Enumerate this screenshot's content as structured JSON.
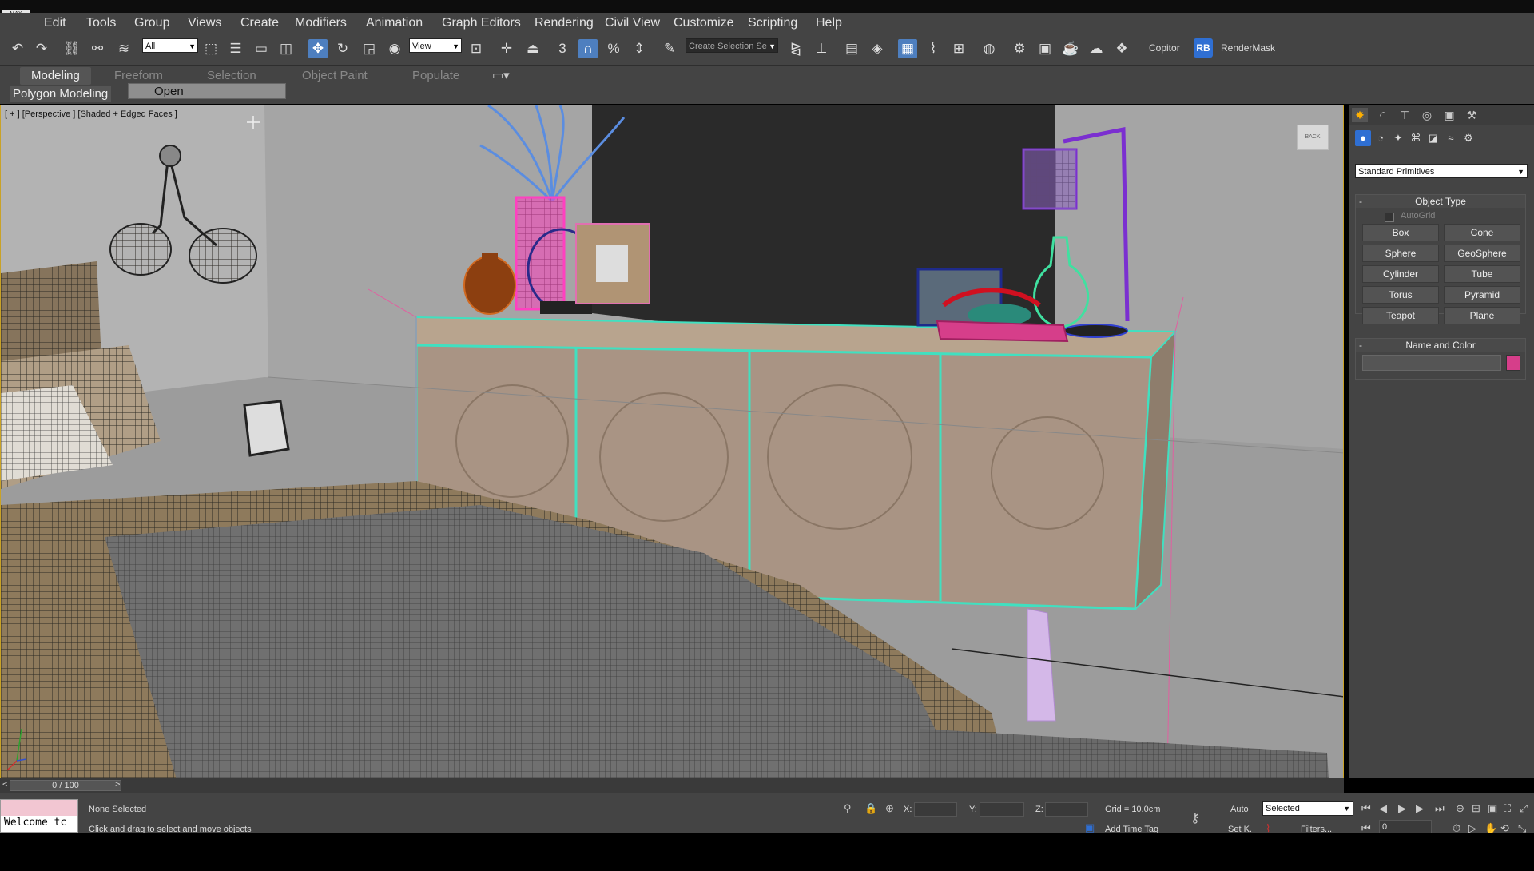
{
  "app": {
    "logo": "MAX"
  },
  "menu": [
    "Edit",
    "Tools",
    "Group",
    "Views",
    "Create",
    "Modifiers",
    "Animation",
    "Graph Editors",
    "Rendering",
    "Civil View",
    "Customize",
    "Scripting",
    "Help"
  ],
  "toolbar": {
    "filter_value": "All",
    "coord_value": "View",
    "snap_label": "3",
    "selection_set_placeholder": "Create Selection Se",
    "copitor_label": "Copitor",
    "rb_label": "RB",
    "rendermask_label": "RenderMask"
  },
  "ribbon": {
    "tabs": [
      "Modeling",
      "Freeform",
      "Selection",
      "Object Paint",
      "Populate"
    ],
    "active_tab": "Modeling",
    "panel_label": "Polygon Modeling",
    "open_label": "Open"
  },
  "viewport": {
    "label": "[ + ] [Perspective ] [Shaded + Edged Faces ]",
    "viewcube_label": "BACK"
  },
  "command_panel": {
    "category": "Standard Primitives",
    "object_type_title": "Object Type",
    "autogrid_label": "AutoGrid",
    "primitives": [
      "Box",
      "Cone",
      "Sphere",
      "GeoSphere",
      "Cylinder",
      "Tube",
      "Torus",
      "Pyramid",
      "Teapot",
      "Plane"
    ],
    "name_color_title": "Name and Color",
    "object_color": "#d63e8a"
  },
  "timeline": {
    "frame": "0 / 100",
    "prev": "<",
    "next": ">"
  },
  "status": {
    "welcome_text": "Welcome tc",
    "selection_text": "None Selected",
    "prompt_text": "Click and drag to select and move objects",
    "x_label": "X:",
    "y_label": "Y:",
    "z_label": "Z:",
    "grid_text": "Grid = 10.0cm",
    "add_time_tag": "Add Time Tag",
    "auto_label": "Auto",
    "setk_label": "Set K.",
    "selected_value": "Selected",
    "filters_label": "Filters...",
    "frame_value": "0"
  }
}
